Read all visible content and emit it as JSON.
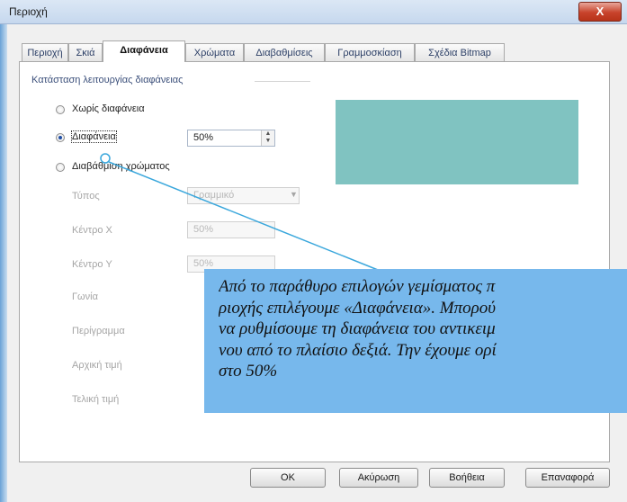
{
  "window": {
    "title": "Περιοχή",
    "close_label": "X"
  },
  "tabs": [
    {
      "label": "Περιοχή",
      "active": false
    },
    {
      "label": "Σκιά",
      "active": false
    },
    {
      "label": "Διαφάνεια",
      "active": true
    },
    {
      "label": "Χρώματα",
      "active": false
    },
    {
      "label": "Διαβαθμίσεις",
      "active": false
    },
    {
      "label": "Γραμμοσκίαση",
      "active": false
    },
    {
      "label": "Σχέδια Bitmap",
      "active": false
    }
  ],
  "transparency": {
    "group_label": "Κατάσταση λειτουργίας διαφάνειας",
    "options": [
      {
        "label": "Χωρίς διαφάνεια",
        "selected": false
      },
      {
        "label": "Διαφάνεια",
        "selected": true
      },
      {
        "label": "Διαβάθμιση χρώματος",
        "selected": false
      }
    ],
    "transparency_value": "50%",
    "gradient": {
      "type_label": "Τύπος",
      "type_value": "Γραμμικό",
      "center_x_label": "Κέντρο X",
      "center_x_value": "50%",
      "center_y_label": "Κέντρο Y",
      "center_y_value": "50%",
      "angle_label": "Γωνία",
      "border_label": "Περίγραμμα",
      "start_label": "Αρχική τιμή",
      "end_label": "Τελική τιμή"
    },
    "preview_color": "#80c3c1"
  },
  "buttons": {
    "ok": "OK",
    "cancel": "Ακύρωση",
    "help": "Βοήθεια",
    "reset": "Επαναφορά"
  },
  "annotation": {
    "lines": [
      "Από το παράθυρο επιλογών γεμίσματος π",
      "ριοχής επιλέγουμε «Διαφάνεια». Μπορού",
      "να ρυθμίσουμε τη διαφάνεια του αντικειμ",
      "νου από το πλαίσιο δεξιά. Την έχουμε ορί",
      "στο 50%"
    ],
    "background": "#77b8ec"
  }
}
